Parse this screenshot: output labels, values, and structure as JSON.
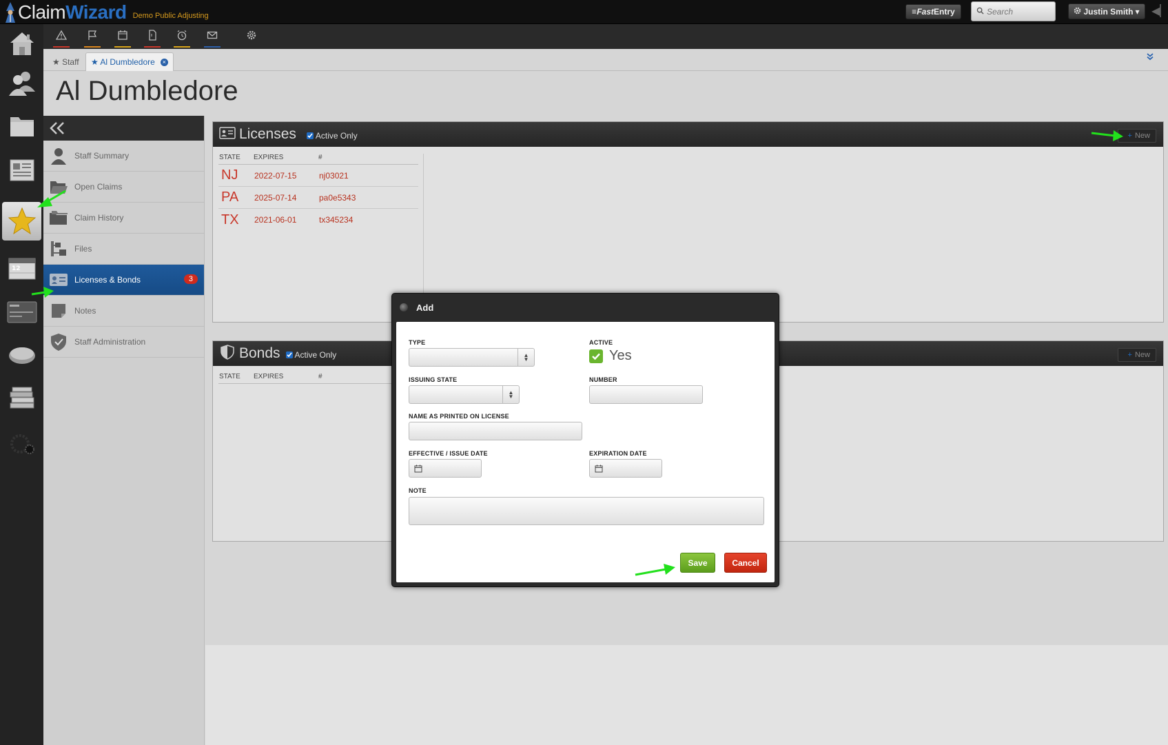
{
  "app": {
    "brand_claim": "Claim",
    "brand_wizard": "Wizard",
    "company": "Demo Public Adjusting"
  },
  "topbar": {
    "fast_entry_prefix": "≡",
    "fast_entry_label_em": "Fast",
    "fast_entry_label": " Entry",
    "search_placeholder": "Search",
    "user_name": "Justin Smith",
    "user_caret": "▾"
  },
  "tabs": {
    "staff": "★ Staff",
    "active": "★ Al Dumbledore",
    "close": "×"
  },
  "page": {
    "title": "Al Dumbledore"
  },
  "nav": {
    "items": [
      {
        "label": "Staff Summary",
        "icon": "person-icon"
      },
      {
        "label": "Open Claims",
        "icon": "open-folder-icon"
      },
      {
        "label": "Claim History",
        "icon": "folders-icon"
      },
      {
        "label": "Files",
        "icon": "files-icon"
      },
      {
        "label": "Licenses & Bonds",
        "icon": "license-card-icon",
        "badge": "3",
        "active": true
      },
      {
        "label": "Notes",
        "icon": "note-icon"
      },
      {
        "label": "Staff Administration",
        "icon": "shield-icon"
      }
    ]
  },
  "licenses": {
    "title": "Licenses",
    "active_only": "Active Only",
    "new_label": "New",
    "headers": {
      "state": "STATE",
      "expires": "EXPIRES",
      "number": "#"
    },
    "rows": [
      {
        "state": "NJ",
        "expires": "2022-07-15",
        "number": "nj03021"
      },
      {
        "state": "PA",
        "expires": "2025-07-14",
        "number": "pa0e5343"
      },
      {
        "state": "TX",
        "expires": "2021-06-01",
        "number": "tx345234"
      }
    ]
  },
  "bonds": {
    "title": "Bonds",
    "active_only": "Active Only",
    "new_label": "New",
    "headers": {
      "state": "STATE",
      "expires": "EXPIRES",
      "number": "#"
    }
  },
  "modal": {
    "title": "Add",
    "type_label": "TYPE",
    "active_label": "ACTIVE",
    "active_value": "Yes",
    "issuing_state_label": "ISSUING STATE",
    "number_label": "NUMBER",
    "name_label": "NAME AS PRINTED ON LICENSE",
    "effective_label": "EFFECTIVE / ISSUE DATE",
    "expiration_label": "EXPIRATION DATE",
    "note_label": "NOTE",
    "save": "Save",
    "cancel": "Cancel"
  },
  "colors": {
    "accent_blue": "#1f5a9b",
    "badge_red": "#d02b1d",
    "license_red": "#c8372a",
    "save_green": "#6ab52e",
    "cancel_red": "#d0321a",
    "annotation_arrow": "#22e01c"
  }
}
